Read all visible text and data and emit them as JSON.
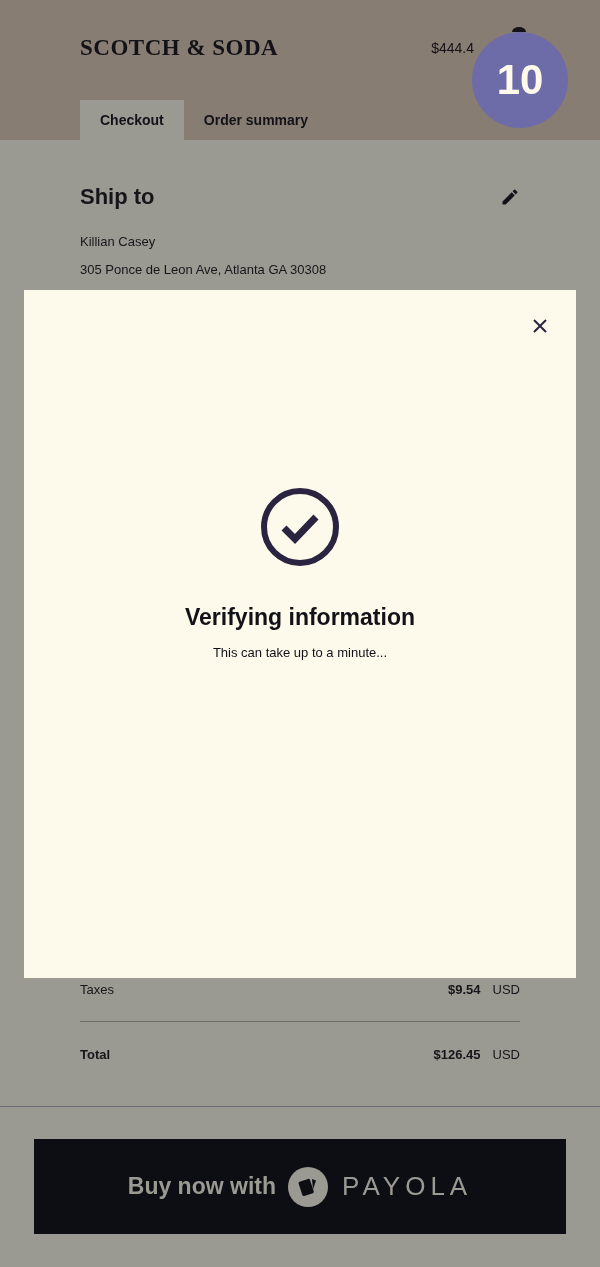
{
  "header": {
    "logo": "SCOTCH & SODA",
    "cart_total": "$444.4",
    "step_badge": "10"
  },
  "tabs": [
    {
      "label": "Checkout",
      "selected": true
    },
    {
      "label": "Order summary",
      "selected": false
    }
  ],
  "ship_to": {
    "title": "Ship to",
    "name": "Killian Casey",
    "address": "305 Ponce de Leon Ave, Atlanta GA 30308"
  },
  "summary": [
    {
      "label": "Taxes",
      "amount": "$9.54",
      "currency": "USD",
      "kind": "line"
    },
    {
      "label": "Total",
      "amount": "$126.45",
      "currency": "USD",
      "kind": "total"
    }
  ],
  "modal": {
    "title": "Verifying information",
    "message": "This can take up to a minute..."
  },
  "pay_button": {
    "text": "Buy now with",
    "brand": "PAYOLA"
  }
}
